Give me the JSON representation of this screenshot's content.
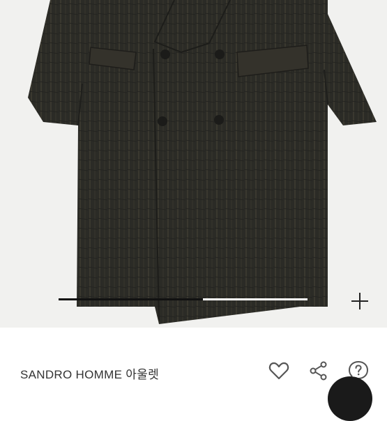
{
  "product": {
    "brand_label": "SANDRO HOMME 아울렛"
  },
  "gallery": {
    "progress": 0.58
  },
  "icons": {
    "expand": "plus-icon",
    "like": "heart-icon",
    "share": "share-icon",
    "help": "question-icon"
  },
  "colors": {
    "coat": "#2b2b26",
    "background": "#f1f1ef",
    "text": "#333333",
    "icon": "#555555"
  }
}
